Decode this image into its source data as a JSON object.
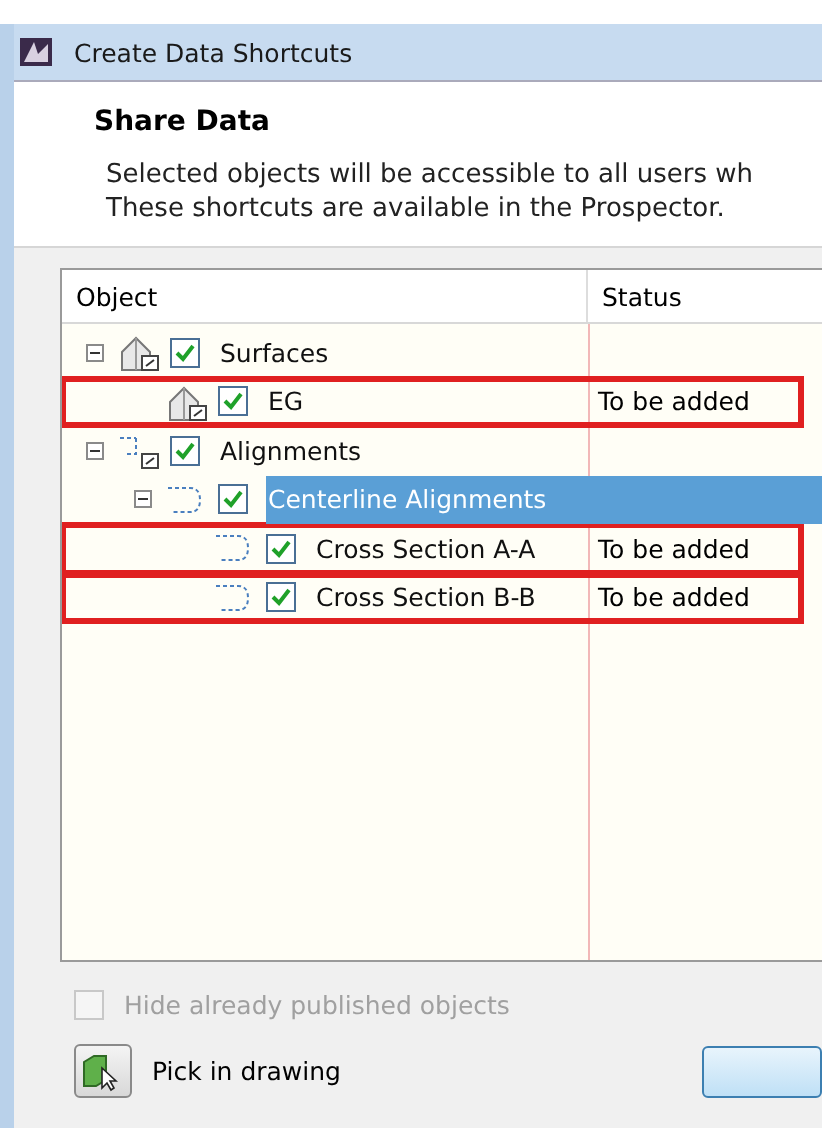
{
  "window": {
    "title": "Create Data Shortcuts"
  },
  "header": {
    "title": "Share Data",
    "description": [
      "Selected objects will be accessible to all users wh",
      "These shortcuts are available in the Prospector."
    ]
  },
  "tree": {
    "columns": [
      "Object",
      "Status"
    ],
    "items": [
      {
        "label": "Surfaces",
        "kind": "surface",
        "checked": true,
        "expanded": true,
        "selected": false,
        "outlined": false,
        "children": [
          {
            "label": "EG",
            "kind": "surface",
            "checked": true,
            "selected": false,
            "outlined": true,
            "status": "To be added"
          }
        ]
      },
      {
        "label": "Alignments",
        "kind": "alignment-group",
        "checked": true,
        "expanded": true,
        "selected": false,
        "outlined": false,
        "children": [
          {
            "label": "Centerline Alignments",
            "kind": "alignment",
            "checked": true,
            "expanded": true,
            "selected": true,
            "outlined": false,
            "children": [
              {
                "label": "Cross Section A-A",
                "kind": "alignment",
                "checked": true,
                "selected": false,
                "outlined": true,
                "status": "To be added"
              },
              {
                "label": "Cross Section B-B",
                "kind": "alignment",
                "checked": true,
                "selected": false,
                "outlined": true,
                "status": "To be added"
              }
            ]
          }
        ]
      }
    ]
  },
  "hide_published": {
    "label": "Hide already published objects",
    "checked": false,
    "disabled": true
  },
  "pick_button": {
    "label": "Pick in drawing"
  }
}
